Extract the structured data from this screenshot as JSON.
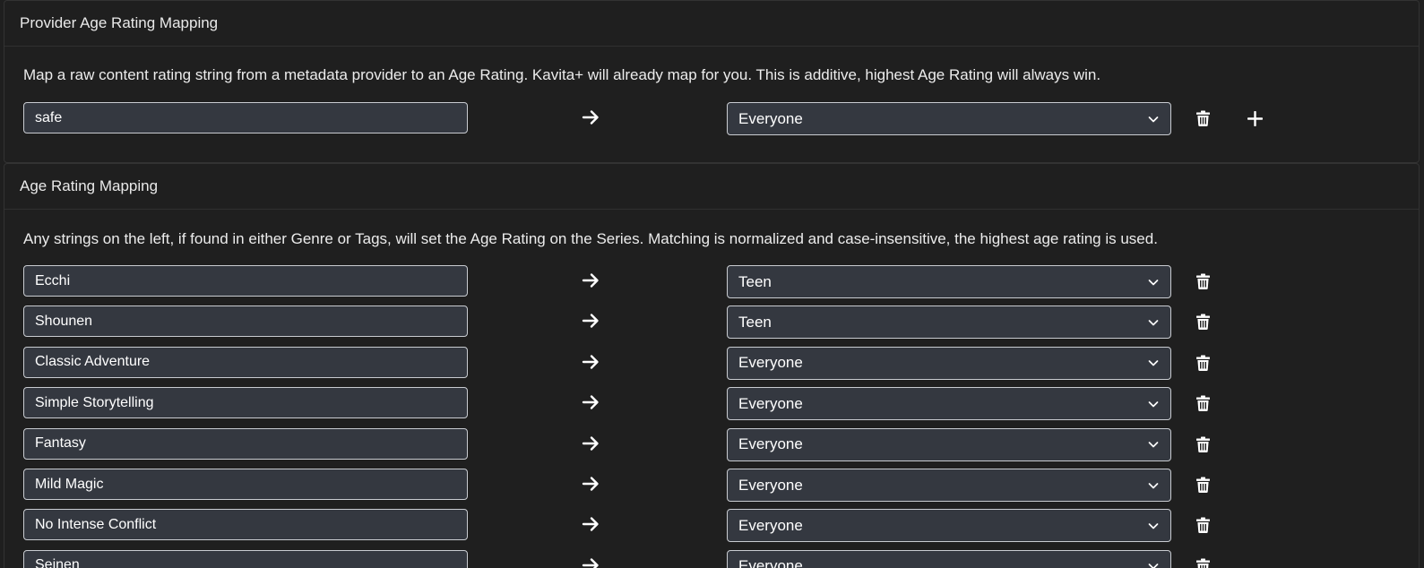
{
  "provider_section": {
    "title": "Provider Age Rating Mapping",
    "description": "Map a raw content rating string from a metadata provider to an Age Rating. Kavita+ will already map for you. This is additive, highest Age Rating will always win.",
    "rows": [
      {
        "source": "safe",
        "rating": "Everyone"
      }
    ]
  },
  "age_section": {
    "title": "Age Rating Mapping",
    "description": "Any strings on the left, if found in either Genre or Tags, will set the Age Rating on the Series. Matching is normalized and case-insensitive, the highest age rating is used.",
    "rows": [
      {
        "source": "Ecchi",
        "rating": "Teen"
      },
      {
        "source": "Shounen",
        "rating": "Teen"
      },
      {
        "source": "Classic Adventure",
        "rating": "Everyone"
      },
      {
        "source": "Simple Storytelling",
        "rating": "Everyone"
      },
      {
        "source": "Fantasy",
        "rating": "Everyone"
      },
      {
        "source": "Mild Magic",
        "rating": "Everyone"
      },
      {
        "source": "No Intense Conflict",
        "rating": "Everyone"
      },
      {
        "source": "Seinen",
        "rating": "Everyone"
      }
    ]
  },
  "icons": {
    "arrow": "arrow-right-icon",
    "chevron": "chevron-down-icon",
    "delete": "trash-icon",
    "add": "plus-icon"
  },
  "colors": {
    "background": "#1f1f1f",
    "input_background": "#343840",
    "input_border": "#c9ccd1"
  }
}
